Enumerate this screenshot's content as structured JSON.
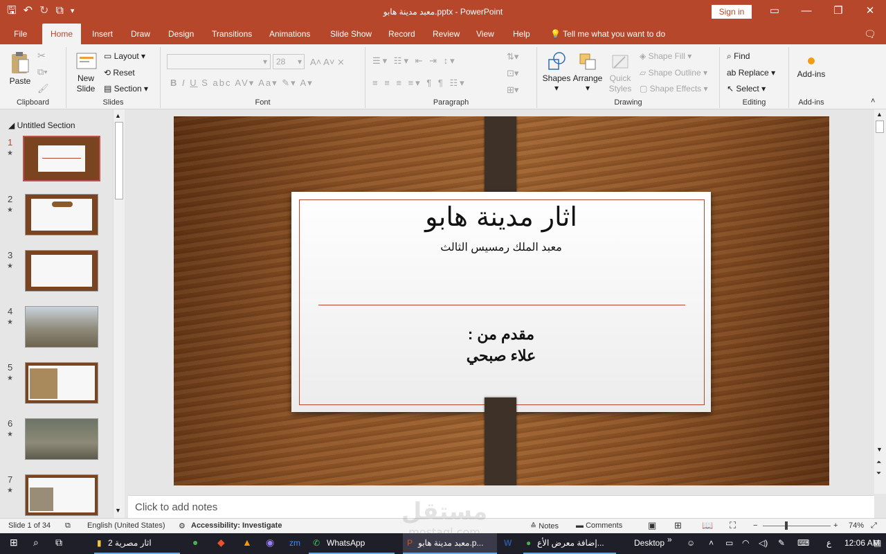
{
  "titlebar": {
    "qat": [
      "save-icon",
      "undo-icon",
      "redo-icon",
      "present-icon",
      "customize-icon"
    ],
    "title": "معبد مدينة هابو.pptx  -  PowerPoint",
    "signin": "Sign in"
  },
  "tabs": [
    "File",
    "Home",
    "Insert",
    "Draw",
    "Design",
    "Transitions",
    "Animations",
    "Slide Show",
    "Record",
    "Review",
    "View",
    "Help"
  ],
  "tellme": "Tell me what you want to do",
  "ribbon": {
    "clipboard": {
      "paste": "Paste",
      "label": "Clipboard"
    },
    "slides": {
      "new_slide": "New Slide",
      "layout": "Layout",
      "reset": "Reset",
      "section": "Section",
      "label": "Slides"
    },
    "font": {
      "size": "28",
      "label": "Font"
    },
    "paragraph": {
      "label": "Paragraph"
    },
    "drawing": {
      "shapes": "Shapes",
      "arrange": "Arrange",
      "quick_styles": "Quick Styles",
      "shape_fill": "Shape Fill",
      "shape_outline": "Shape Outline",
      "shape_effects": "Shape Effects",
      "label": "Drawing"
    },
    "editing": {
      "find": "Find",
      "replace": "Replace",
      "select": "Select",
      "label": "Editing"
    },
    "addins": {
      "addins": "Add-ins",
      "label": "Add-ins"
    }
  },
  "left_pane": {
    "section": "Untitled Section",
    "slides": [
      "1",
      "2",
      "3",
      "4",
      "5",
      "6",
      "7"
    ]
  },
  "slide": {
    "title": "اثار مدينة هابو",
    "subtitle": "معبد الملك رمسيس الثالث",
    "presenter_label": "مقدم من :",
    "presenter_name": "علاء صبحي"
  },
  "notes": {
    "placeholder": "Click to add notes"
  },
  "status": {
    "slide": "Slide 1 of 34",
    "language": "English (United States)",
    "accessibility": "Accessibility: Investigate",
    "notes": "Notes",
    "comments": "Comments",
    "zoom": "74%"
  },
  "taskbar": {
    "items": [
      "اثار مصرية 2",
      "WhatsApp",
      "معبد مدينة هابو.p...",
      "إضافة معرض الأع..."
    ],
    "desktop": "Desktop",
    "lang": "ع",
    "time": "12:06 AM"
  },
  "watermark": {
    "text": "mostaql.com"
  },
  "colors": {
    "accent": "#b7472a",
    "taskbar": "#1f1f2a"
  }
}
